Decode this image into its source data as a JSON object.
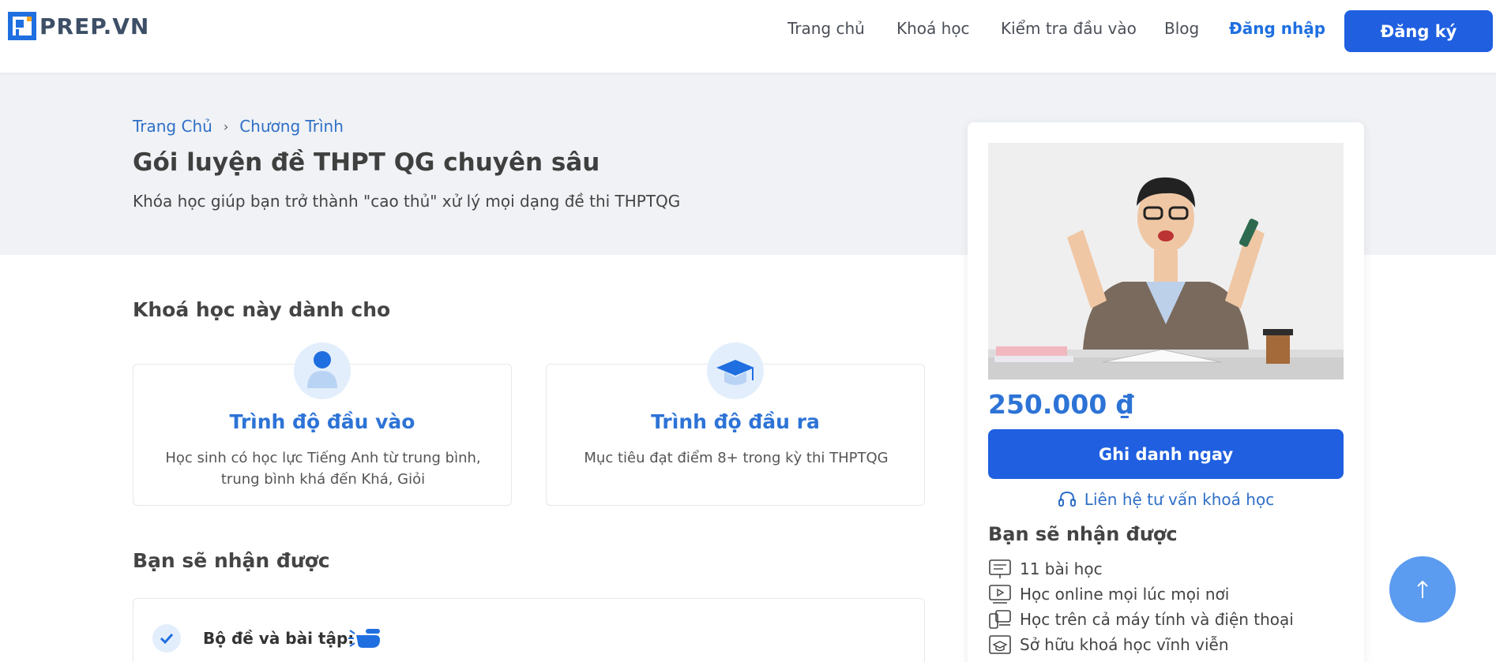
{
  "brand": {
    "name": "PREP.VN",
    "accent": "#1f5fe0",
    "link_color": "#2f6fc7"
  },
  "nav": {
    "items": [
      "Trang chủ",
      "Khoá học",
      "Kiểm tra đầu vào",
      "Blog"
    ],
    "login": "Đăng nhập",
    "register": "Đăng ký"
  },
  "breadcrumb": {
    "home": "Trang Chủ",
    "current": "Chương Trình"
  },
  "page": {
    "title": "Gói luyện đề THPT QG chuyên sâu",
    "subtitle": "Khóa học giúp bạn trở thành \"cao thủ\" xử lý mọi dạng đề thi THPTQG"
  },
  "audience": {
    "heading": "Khoá học này dành cho",
    "cards": [
      {
        "icon": "user-icon",
        "title": "Trình độ đầu vào",
        "desc": "Học sinh có học lực Tiếng Anh từ trung bình, trung bình khá đến Khá, Giỏi"
      },
      {
        "icon": "graduation-cap-icon",
        "title": "Trình độ đầu ra",
        "desc": "Mục tiêu đạt điểm 8+ trong kỳ thi THPTQG"
      }
    ]
  },
  "benefits": {
    "heading": "Bạn sẽ nhận được",
    "items": [
      {
        "label": "Bộ đề và bài tập:"
      }
    ]
  },
  "side": {
    "price": "250.000 ₫",
    "enroll": "Ghi danh ngay",
    "contact": "Liên hệ tư vấn khoá học",
    "heading": "Bạn sẽ nhận được",
    "features": [
      {
        "icon": "lessons-icon",
        "text": "11 bài học"
      },
      {
        "icon": "online-video-icon",
        "text": "Học online mọi lúc mọi nơi"
      },
      {
        "icon": "devices-icon",
        "text": "Học trên cả máy tính và điện thoại"
      },
      {
        "icon": "lifetime-access-icon",
        "text": "Sở hữu khoá học vĩnh viễn"
      }
    ]
  }
}
